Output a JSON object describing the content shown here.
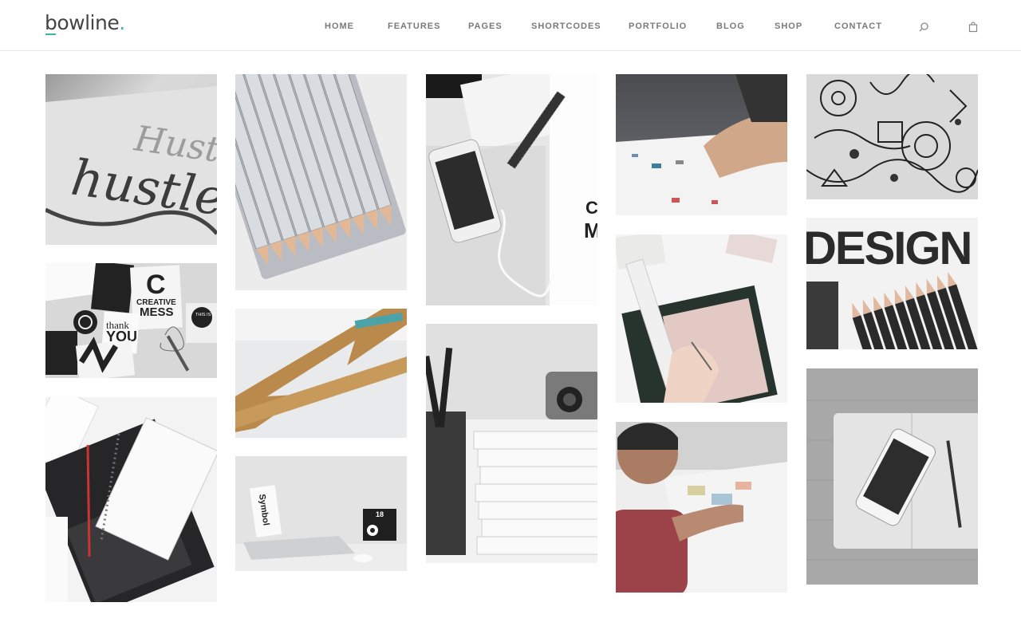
{
  "brand": {
    "name": "bowline",
    "dot": "."
  },
  "nav": {
    "items": [
      {
        "label": "HOME"
      },
      {
        "label": "FEATURES"
      },
      {
        "label": "PAGES"
      },
      {
        "label": "SHORTCODES"
      },
      {
        "label": "PORTFOLIO"
      },
      {
        "label": "BLOG"
      },
      {
        "label": "SHOP"
      },
      {
        "label": "CONTACT"
      }
    ],
    "icons": [
      "search-icon",
      "shopping-bag-icon"
    ]
  },
  "colors": {
    "accent": "#3cb6a0",
    "nav_text": "#7a7a7a"
  },
  "gallery": {
    "images": [
      {
        "name": "portfolio-image-hustle-lettering",
        "subject": "hustle lettering sketch",
        "words": [
          "hustle",
          "Hustle"
        ]
      },
      {
        "name": "portfolio-image-colored-pencils",
        "subject": "row of colored pencils"
      },
      {
        "name": "portfolio-image-phone-desk",
        "subject": "smartphone, pen and earphones on desk",
        "words": [
          "C",
          "M"
        ]
      },
      {
        "name": "portfolio-image-hands-paper",
        "subject": "hand on paper documents"
      },
      {
        "name": "portfolio-image-doodle-art",
        "subject": "black and white doodle artwork"
      },
      {
        "name": "portfolio-image-creative-mess",
        "subject": "creative mess stickers",
        "words": [
          "C",
          "CREATIVE",
          "MESS",
          "thank",
          "YOU",
          "THIS IS IT"
        ]
      },
      {
        "name": "portfolio-image-wooden-triangle",
        "subject": "wooden triangle ruler"
      },
      {
        "name": "portfolio-image-cutting-mat",
        "subject": "hands drawing on cutting mat"
      },
      {
        "name": "portfolio-image-design-pencils",
        "subject": "design text with pencils",
        "words": [
          "DESIGN"
        ]
      },
      {
        "name": "portfolio-image-notebook-pen",
        "subject": "spiral notebook and pen"
      },
      {
        "name": "portfolio-image-laptop-desk",
        "subject": "laptop, books and calendar",
        "words": [
          "Symbol",
          "18"
        ]
      },
      {
        "name": "portfolio-image-book-stack",
        "subject": "stack of books with camera"
      },
      {
        "name": "portfolio-image-man-working",
        "subject": "man working at desk"
      },
      {
        "name": "portfolio-image-phone-notebook",
        "subject": "phone on open notebook"
      }
    ]
  }
}
